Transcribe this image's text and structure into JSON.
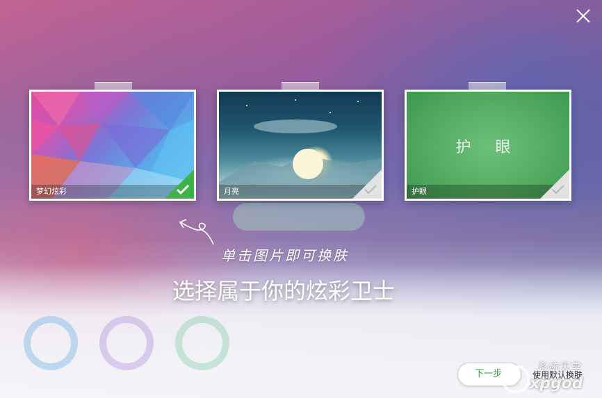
{
  "skins": [
    {
      "label": "梦幻炫彩",
      "selected": true
    },
    {
      "label": "月亮",
      "selected": false
    },
    {
      "label": "护眼",
      "selected": false,
      "center_text": "护 眼"
    }
  ],
  "hint": "单击图片即可换肤",
  "title": "选择属于你的炫彩卫士",
  "next_label": "下一步",
  "default_skin_label": "使用默认换肤",
  "watermark": {
    "top": "系统天堂",
    "bottom": "xpgod"
  },
  "colors": {
    "accent": "#2aa43e",
    "check_selected": "#3db24a",
    "check_unselected": "#d8d8d8"
  }
}
